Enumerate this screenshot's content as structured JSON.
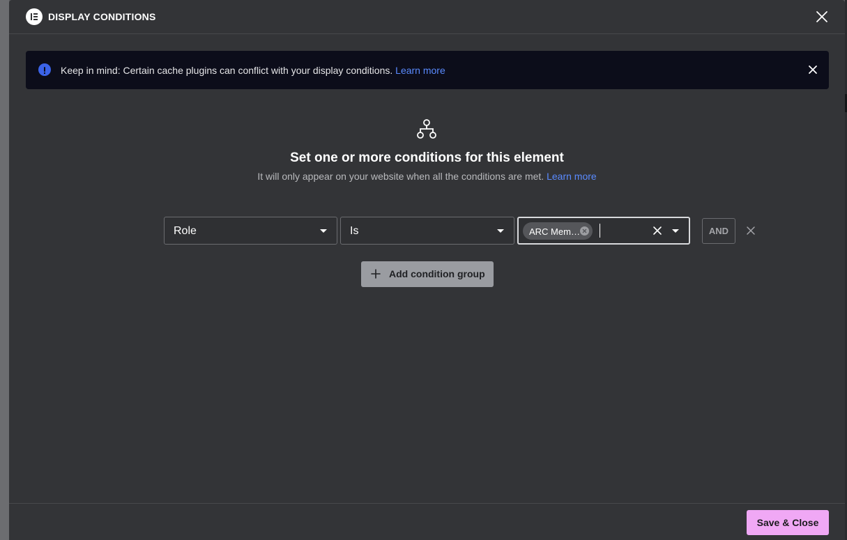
{
  "modal": {
    "title": "DISPLAY CONDITIONS"
  },
  "notice": {
    "text": "Keep in mind: Certain cache plugins can conflict with your display conditions.",
    "link": "Learn more"
  },
  "intro": {
    "heading": "Set one or more conditions for this element",
    "subtext": "It will only appear on your website when all the conditions are met.",
    "link": "Learn more"
  },
  "condition": {
    "field": "Role",
    "operator": "Is",
    "values": [
      "ARC Mem…"
    ],
    "input_value": "",
    "connector": "AND"
  },
  "actions": {
    "add_group": "Add condition group",
    "save": "Save & Close"
  },
  "colors": {
    "modal_bg": "#333437",
    "notice_bg": "#0c0d1a",
    "link": "#5a8bff",
    "save_button": "#f0a8f5",
    "add_group_button": "#9a9ca1"
  },
  "icons": {
    "logo": "elementor-logo-icon",
    "close": "close-icon",
    "info": "info-icon",
    "hierarchy": "hierarchy-icon",
    "caret": "caret-down-icon",
    "chip_remove": "remove-circle-icon",
    "plus": "plus-icon"
  }
}
